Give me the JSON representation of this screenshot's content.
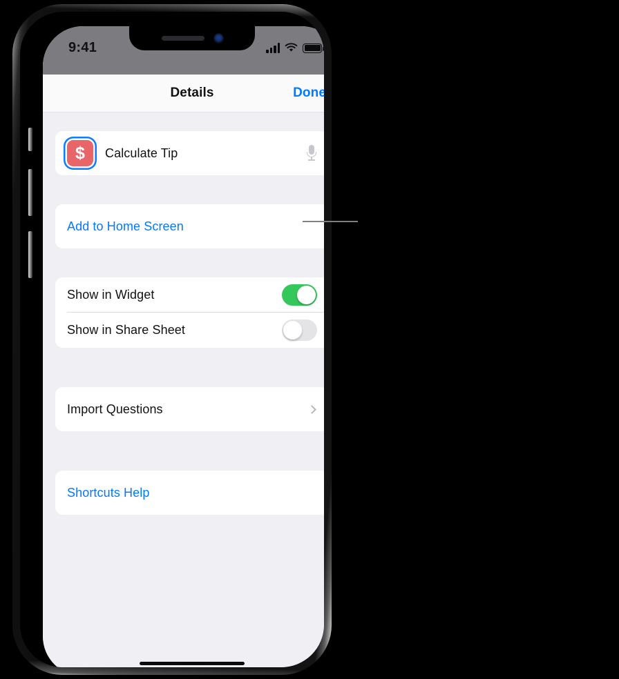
{
  "status_bar": {
    "time": "9:41",
    "icons": [
      "cellular-signal-icon",
      "wifi-icon",
      "battery-icon"
    ]
  },
  "nav_bar": {
    "title": "Details",
    "done_label": "Done"
  },
  "shortcut": {
    "name": "Calculate Tip",
    "icon_glyph": "$",
    "icon_color": "#e8656a",
    "selection_color": "#0a7cff",
    "mic_icon": "microphone-icon"
  },
  "home_screen_section": {
    "label": "Add to Home Screen"
  },
  "toggles": [
    {
      "label": "Show in Widget",
      "state": "on"
    },
    {
      "label": "Show in Share Sheet",
      "state": "off"
    }
  ],
  "import_section": {
    "label": "Import Questions",
    "accessory": "chevron-right-icon"
  },
  "help_section": {
    "label": "Shortcuts Help"
  },
  "colors": {
    "accent_blue": "#007aff",
    "toggle_on_green": "#34c759",
    "toggle_off_gray": "#e4e4e6",
    "screen_background": "#f0f0f4",
    "status_bar_gray": "#7c7c80"
  }
}
